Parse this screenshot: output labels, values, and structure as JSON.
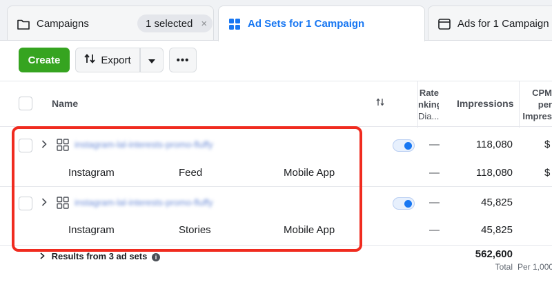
{
  "tabs": {
    "campaigns": {
      "label": "Campaigns",
      "selected_badge": "1 selected",
      "clear": "×"
    },
    "adsets": {
      "label": "Ad Sets for 1 Campaign"
    },
    "ads": {
      "label": "Ads for 1 Campaign"
    }
  },
  "toolbar": {
    "create_label": "Create",
    "export_label": "Export",
    "more_label": "•••"
  },
  "table": {
    "headers": {
      "name": "Name",
      "rate_line1": "Rate",
      "rate_line2": "nking",
      "rate_line3": "Dia...",
      "impressions": "Impressions",
      "cpm_line1": "CPM",
      "cpm_line2": "per",
      "cpm_line3": "Impres"
    },
    "rows": [
      {
        "name": "instagram-lal-interests-promo-fluffy",
        "toggle_on": true,
        "rate": "—",
        "impressions": "118,080",
        "cpm": "$",
        "breakdown": {
          "platform": "Instagram",
          "placement": "Feed",
          "device": "Mobile App",
          "rate": "—",
          "impressions": "118,080",
          "cpm": "$"
        }
      },
      {
        "name": "instagram-lal-interests-promo-fluffy",
        "toggle_on": true,
        "rate": "—",
        "impressions": "45,825",
        "cpm": "",
        "breakdown": {
          "platform": "Instagram",
          "placement": "Stories",
          "device": "Mobile App",
          "rate": "—",
          "impressions": "45,825",
          "cpm": ""
        }
      }
    ],
    "footer": {
      "results_label": "Results from 3 ad sets",
      "total_impressions": "562,600",
      "total_label": "Total",
      "per_label": "Per 1,000"
    }
  },
  "colors": {
    "accent": "#1877f2",
    "create_green": "#36a420",
    "highlight_red": "#f02b1f"
  }
}
